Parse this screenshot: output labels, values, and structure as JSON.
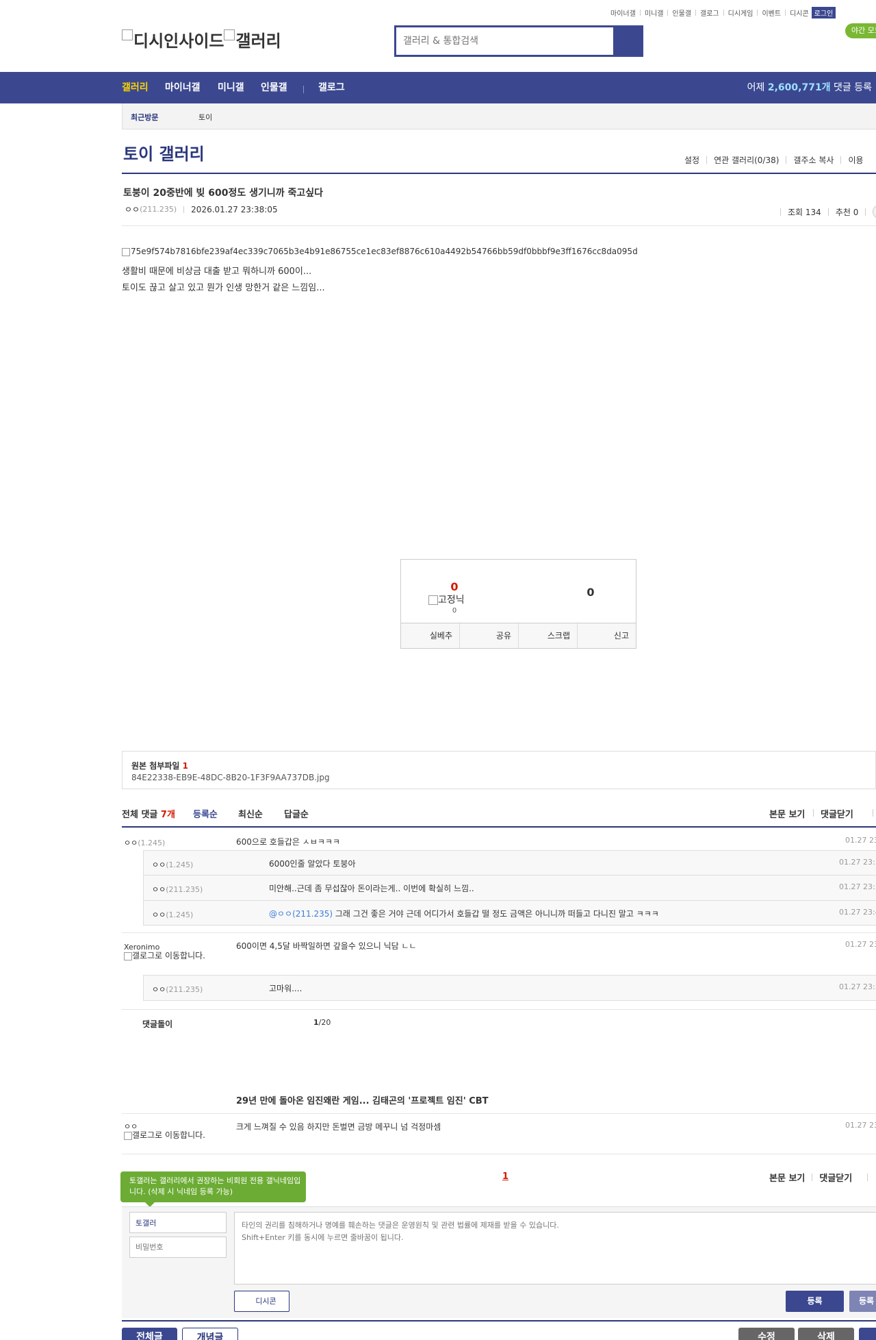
{
  "util": {
    "items": [
      "마이너갤",
      "미니갤",
      "인물갤",
      "갤로그",
      "디시게임",
      "이벤트",
      "디시콘"
    ],
    "login": "로그인",
    "night_mode": "야간 모드"
  },
  "header": {
    "logo_alt": "디시인사이드",
    "gallery_alt": "갤러리",
    "search_placeholder": "갤러리 & 통합검색"
  },
  "nav": {
    "items": [
      "갤러리",
      "마이너갤",
      "미니갤",
      "인물갤"
    ],
    "gallog": "갤로그",
    "yesterday_prefix": "어제 ",
    "yesterday_count": "2,600,771개",
    "yesterday_suffix": " 댓글 등록"
  },
  "recent": {
    "title": "최근방문",
    "gallery": "토이"
  },
  "gallery": {
    "title": "토이 갤러리",
    "menu": [
      "설정",
      "연관 갤러리(0/38)",
      "갤주소 복사",
      "이용"
    ]
  },
  "post": {
    "title": "토붕이 20중반에 빚 600정도 생기니까 죽고싶다",
    "nick": "ㅇㅇ",
    "ip": "(211.235)",
    "date": "2026.01.27 23:38:05",
    "views": "조회 134",
    "recommend": "추천 0",
    "image_alt": "75e9f574b7816bfe239af4ec339c7065b3e4b91e86755ce1ec83ef8876c610a4492b54766bb59df0bbbf9e3ff1676cc8da095d",
    "body": [
      "생활비 때문에 비상금 대출 받고 뭐하니까 600이...",
      "토이도 끊고 살고 있고 뭔가 인생 망한거 같은 느낌임..."
    ]
  },
  "recommend_box": {
    "up": "0",
    "fix_alt": "고정닉",
    "fix_count": "0",
    "down": "0",
    "buttons": [
      "실베추",
      "공유",
      "스크랩",
      "신고"
    ]
  },
  "attach": {
    "title": "원본 첨부파일",
    "count": "1",
    "file": "84E22338-EB9E-48DC-8B20-1F3F9AA737DB.jpg"
  },
  "comments_header": {
    "total_label": "전체 댓글",
    "total_count": "7개",
    "sorts": [
      "등록순",
      "최신순",
      "답글순"
    ],
    "view_body": "본문 보기",
    "close_comments": "댓글닫기"
  },
  "comments": [
    {
      "nick": "ㅇㅇ",
      "ip": "(1.245)",
      "text": "600으로 호들갑은 ㅅㅂㅋㅋㅋ",
      "date": "01.27 23:"
    },
    {
      "nick": "ㅇㅇ",
      "ip": "(1.245)",
      "text": "6000인줄 알았다 토붕아",
      "date": "01.27 23:3"
    },
    {
      "nick": "ㅇㅇ",
      "ip": "(211.235)",
      "text": "미안해..근데 좀 무섭잖아 돈이라는게.. 이번에 확실히 느낌..",
      "date": "01.27 23:3"
    },
    {
      "nick": "ㅇㅇ",
      "ip": "(1.245)",
      "mention": "@ㅇㅇ(211.235)",
      "text": " 그래 그건 좋은 거야 근데 어디가서 호들갑 떨 정도 금액은 아니니까 떠들고 다니진 말고 ㅋㅋㅋ",
      "date": "01.27 23:4"
    },
    {
      "nick": "Xeronimo",
      "gallog_alt": "갤로그로 이동합니다.",
      "text": "600이면 4,5달 바짝일하면 갚을수 있으니 닉담 ㄴㄴ",
      "date": "01.27 23:"
    },
    {
      "nick": "ㅇㅇ",
      "ip": "(211.235)",
      "text": "고마워....",
      "date": "01.27 23:3"
    }
  ],
  "dolly": {
    "label": "댓글돌이",
    "page_current": "1",
    "page_total": "/20"
  },
  "ad": {
    "title": "29년 만에 돌아온 임진왜란 게임... 김태곤의 '프로젝트 임진' CBT",
    "nick": "ㅇㅇ",
    "gallog_alt": "갤로그로 이동합니다.",
    "text": "크게 느껴질 수 있음 하지만 돈벌면 금방 메꾸니 넘 걱정마셈",
    "date": "01.27 23:"
  },
  "pagination": {
    "current": "1"
  },
  "write": {
    "tip": "토갤러는 갤러리에서 권장하는 비회원 전용 갤닉네임입니다. (삭제 시 닉네임 등록 가능)",
    "nick_value": "토갤러",
    "password_placeholder": "비밀번호",
    "textarea_placeholder": "타인의 권리를 침해하거나 명예를 훼손하는 댓글은 운영원칙 및 관련 법률에 제재를 받을 수 있습니다.\nShift+Enter 키를 동시에 누르면 줄바꿈이 됩니다.",
    "dccon": "디시콘",
    "register": "등록",
    "register2": "등록"
  },
  "bottom_buttons": {
    "all": "전체글",
    "recommend": "개념글",
    "edit": "수정",
    "delete": "삭제"
  },
  "colors": {
    "primary": "#3b4890",
    "accent_yellow": "#ffd400",
    "red": "#d31900",
    "green": "#6cac35"
  }
}
